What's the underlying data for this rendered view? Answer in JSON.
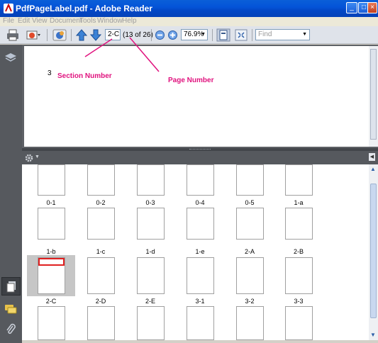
{
  "window": {
    "title": "PdfPageLabel.pdf - Adobe Reader"
  },
  "menubar": {
    "items": [
      "File",
      "Edit",
      "View",
      "Document",
      "Tools",
      "Window",
      "Help"
    ]
  },
  "toolbar": {
    "page_label_value": "2-C",
    "page_count_text": "(13 of 26)",
    "zoom_value": "76.9%",
    "find_placeholder": "Find"
  },
  "document": {
    "visible_page_number": "3"
  },
  "annotations": {
    "section_number": "Section Number",
    "page_number": "Page Number"
  },
  "thumbnails": {
    "selected": "2-C",
    "rows": [
      [
        "0-1",
        "0-2",
        "0-3",
        "0-4",
        "0-5",
        "1-a"
      ],
      [
        "1-b",
        "1-c",
        "1-d",
        "1-e",
        "2-A",
        "2-B"
      ],
      [
        "2-C",
        "2-D",
        "2-E",
        "3-1",
        "3-2",
        "3-3"
      ]
    ]
  },
  "colors": {
    "annotation": "#e0127e",
    "titlebar": "#0454d8",
    "selection_border": "#e02020"
  }
}
